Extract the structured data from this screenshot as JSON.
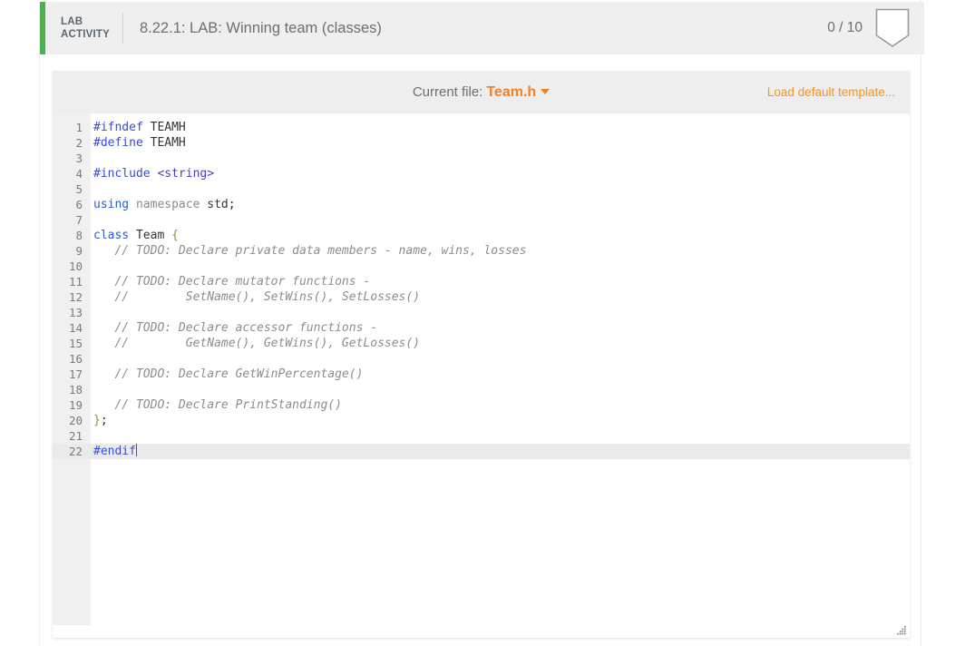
{
  "header": {
    "badge_line1": "LAB",
    "badge_line2": "ACTIVITY",
    "title": "8.22.1: LAB: Winning team (classes)",
    "score": "0 / 10",
    "accent_color": "#4eaf53",
    "bookmark_icon": "bookmark-outline-icon"
  },
  "toolbar": {
    "current_file_label": "Current file:",
    "current_file_name": "Team.h",
    "dropdown_icon": "chevron-down-icon",
    "load_default_template": "Load default template...",
    "accent_color": "#f7941e"
  },
  "editor": {
    "resize_icon": "resize-grip-icon",
    "active_line": 22,
    "cursor_line": 22,
    "lines": [
      {
        "n": "1",
        "tokens": [
          {
            "t": "#ifndef",
            "c": "tk-pre"
          },
          {
            "t": " TEAMH",
            "c": "tk-plain"
          }
        ]
      },
      {
        "n": "2",
        "tokens": [
          {
            "t": "#define",
            "c": "tk-pre"
          },
          {
            "t": " TEAMH",
            "c": "tk-plain"
          }
        ]
      },
      {
        "n": "3",
        "tokens": []
      },
      {
        "n": "4",
        "tokens": [
          {
            "t": "#include",
            "c": "tk-pre"
          },
          {
            "t": " ",
            "c": "tk-plain"
          },
          {
            "t": "<string>",
            "c": "tk-inc"
          }
        ]
      },
      {
        "n": "5",
        "tokens": []
      },
      {
        "n": "6",
        "tokens": [
          {
            "t": "using",
            "c": "tk-kw"
          },
          {
            "t": " ",
            "c": "tk-plain"
          },
          {
            "t": "namespace",
            "c": "tk-ns"
          },
          {
            "t": " std;",
            "c": "tk-plain"
          }
        ]
      },
      {
        "n": "7",
        "tokens": []
      },
      {
        "n": "8",
        "tokens": [
          {
            "t": "class",
            "c": "tk-kw"
          },
          {
            "t": " Team ",
            "c": "tk-plain"
          },
          {
            "t": "{",
            "c": "tk-brace"
          }
        ]
      },
      {
        "n": "9",
        "tokens": [
          {
            "t": "   // TODO: Declare private data members - name, wins, losses",
            "c": "tk-cmt"
          }
        ]
      },
      {
        "n": "10",
        "tokens": []
      },
      {
        "n": "11",
        "tokens": [
          {
            "t": "   // TODO: Declare mutator functions -",
            "c": "tk-cmt"
          }
        ]
      },
      {
        "n": "12",
        "tokens": [
          {
            "t": "   //        SetName(), SetWins(), SetLosses()",
            "c": "tk-cmt"
          }
        ]
      },
      {
        "n": "13",
        "tokens": []
      },
      {
        "n": "14",
        "tokens": [
          {
            "t": "   // TODO: Declare accessor functions -",
            "c": "tk-cmt"
          }
        ]
      },
      {
        "n": "15",
        "tokens": [
          {
            "t": "   //        GetName(), GetWins(), GetLosses()",
            "c": "tk-cmt"
          }
        ]
      },
      {
        "n": "16",
        "tokens": []
      },
      {
        "n": "17",
        "tokens": [
          {
            "t": "   // TODO: Declare GetWinPercentage()",
            "c": "tk-cmt"
          }
        ]
      },
      {
        "n": "18",
        "tokens": []
      },
      {
        "n": "19",
        "tokens": [
          {
            "t": "   // TODO: Declare PrintStanding()",
            "c": "tk-cmt"
          }
        ]
      },
      {
        "n": "20",
        "tokens": [
          {
            "t": "}",
            "c": "tk-brace"
          },
          {
            "t": ";",
            "c": "tk-plain"
          }
        ]
      },
      {
        "n": "21",
        "tokens": []
      },
      {
        "n": "22",
        "tokens": [
          {
            "t": "#endif",
            "c": "tk-pre"
          }
        ]
      }
    ]
  }
}
